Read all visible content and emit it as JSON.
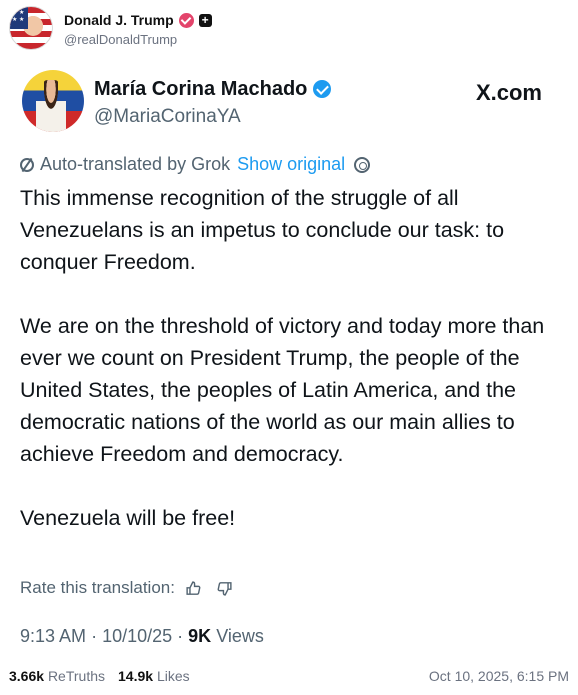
{
  "outer_post": {
    "author_name": "Donald J. Trump",
    "author_handle": "@realDonaldTrump",
    "verified_color": "#e3446b"
  },
  "embedded_tweet": {
    "author_name": "María Corina Machado",
    "author_handle": "@MariaCorinaYA",
    "verified_color": "#1d9bf0",
    "source_domain": "X.com",
    "translation_label": "Auto-translated by Grok",
    "show_original_label": "Show original",
    "paragraphs": [
      "This immense recognition of the struggle of all Venezuelans is an impetus to conclude our task: to conquer Freedom.",
      "We are on the threshold of victory and today more than ever we count on President Trump, the people of the United States, the peoples of Latin America, and the democratic nations of the world as our main allies to achieve Freedom and democracy.",
      "Venezuela will be free!"
    ],
    "rate_label": "Rate this translation:",
    "time": "9:13 AM",
    "date": "10/10/25",
    "views_count": "9K",
    "views_label": "Views"
  },
  "footer": {
    "retruths_count": "3.66k",
    "retruths_label": "ReTruths",
    "likes_count": "14.9k",
    "likes_label": "Likes",
    "timestamp": "Oct 10, 2025, 6:15 PM"
  },
  "icons": [
    "grok-icon",
    "gear-icon",
    "thumbs-up-icon",
    "thumbs-down-icon",
    "verified-badge-icon",
    "plus-badge-icon"
  ]
}
